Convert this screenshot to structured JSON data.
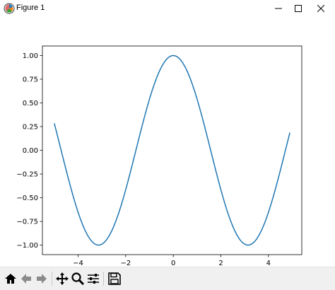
{
  "window": {
    "title": "Figure 1",
    "app_icon": "matplotlib-icon",
    "controls": [
      "minimize-icon",
      "maximize-icon",
      "close-icon"
    ]
  },
  "toolbar": {
    "buttons": [
      "home-icon",
      "back-arrow-icon",
      "forward-arrow-icon",
      "pan-icon",
      "zoom-icon",
      "configure-subplots-icon",
      "save-icon"
    ]
  },
  "chart_data": {
    "type": "line",
    "title": "",
    "xlabel": "",
    "ylabel": "",
    "x_function": "cos(x)",
    "x_range": [
      -5,
      4.9
    ],
    "x_step": 0.1,
    "xlim": [
      -5.5,
      5.4
    ],
    "ylim": [
      -1.1,
      1.1
    ],
    "xticks": [
      -4,
      -2,
      0,
      2,
      4
    ],
    "xtick_labels": [
      "−4",
      "−2",
      "0",
      "2",
      "4"
    ],
    "yticks": [
      -1.0,
      -0.75,
      -0.5,
      -0.25,
      0.0,
      0.25,
      0.5,
      0.75,
      1.0
    ],
    "ytick_labels": [
      "−1.00",
      "−0.75",
      "−0.50",
      "−0.25",
      "0.00",
      "0.25",
      "0.50",
      "0.75",
      "1.00"
    ],
    "line_color": "#1f77b4",
    "grid": false
  }
}
